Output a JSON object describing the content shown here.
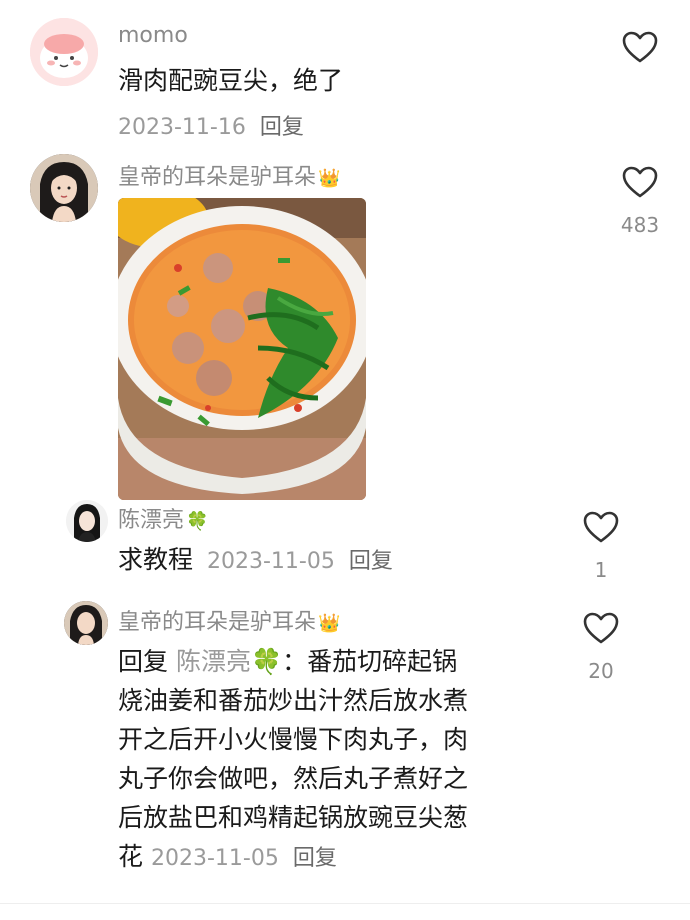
{
  "comments": [
    {
      "user": "momo",
      "text": "滑肉配豌豆尖，绝了",
      "date": "2023-11-16",
      "reply": "回复",
      "likes": ""
    },
    {
      "user": "皇帝的耳朵是驴耳朵",
      "badge": "👑",
      "date": "",
      "likes": "483",
      "image": "soup-photo"
    },
    {
      "user": "陈漂亮",
      "badge": "🍀",
      "text": "求教程",
      "date": "2023-11-05",
      "reply": "回复",
      "likes": "1"
    },
    {
      "user": "皇帝的耳朵是驴耳朵",
      "badge": "👑",
      "reply_prefix": "回复",
      "reply_to": "陈漂亮🍀",
      "text_line1": "：番茄切碎起锅",
      "text_line2": "烧油姜和番茄炒出汁然后放水煮",
      "text_line3": "开之后开小火慢慢下肉丸子，肉",
      "text_line4": "丸子你会做吧，然后丸子煮好之",
      "text_line5": "后放盐巴和鸡精起锅放豌豆尖葱",
      "text_line6": "花",
      "date": "2023-11-05",
      "reply": "回复",
      "likes": "20"
    }
  ],
  "colors": {
    "text": "#1a1a1a",
    "username": "#8a8a8a",
    "meta": "#9a9a9a",
    "heart_outline": "#333333"
  },
  "icons": {
    "like": "heart-outline-icon",
    "crown": "crown-badge-icon",
    "clover": "clover-badge-icon"
  }
}
